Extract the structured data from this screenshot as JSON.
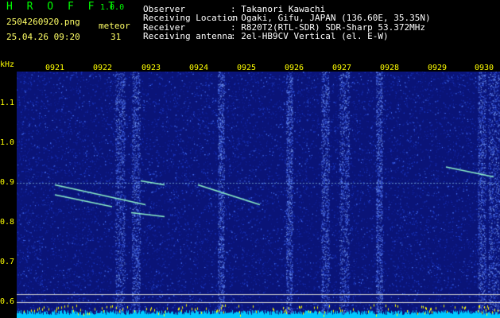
{
  "header": {
    "title": "H R O F F T",
    "version": "1.0.0",
    "filename": "2504260920.png",
    "meteor_label": "meteor",
    "datetime": "25.04.26 09:20",
    "meteor_count": "31",
    "info": [
      {
        "key": "Observer",
        "value": ": Takanori Kawachi"
      },
      {
        "key": "Receiving Location",
        "value": ": Ogaki, Gifu, JAPAN (136.60E, 35.35N)"
      },
      {
        "key": "Receiver",
        "value": ": R820T2(RTL-SDR) SDR-Sharp 53.372MHz"
      },
      {
        "key": "Receiving antenna",
        "value": ": 2el-HB9CV Vertical (el. E-W)"
      }
    ]
  },
  "chart_data": {
    "type": "heatmap",
    "ylabel": "kHz",
    "x_ticks": [
      "0921",
      "0922",
      "0923",
      "0924",
      "0925",
      "0926",
      "0927",
      "0928",
      "0929",
      "0930"
    ],
    "y_ticks": [
      "1.1",
      "1.0",
      "0.9",
      "0.8",
      "0.7",
      "0.6"
    ],
    "ylim": [
      0.58,
      1.18
    ],
    "carrier_khz": 0.9,
    "colors": {
      "background": "#0a1478",
      "noise": "#1e3cc8",
      "signal": "#8cf0c8",
      "carrier": "#aaeeff",
      "minute_line": "#3c5ad2",
      "bottom_bars": "#00c8ff",
      "bottom_peaks": "#ffff00"
    },
    "echoes": [
      {
        "t_start": "0921.0",
        "t_end": "0922.9",
        "f_start": 0.895,
        "f_end": 0.845
      },
      {
        "t_start": "0921.0",
        "t_end": "0922.2",
        "f_start": 0.87,
        "f_end": 0.84
      },
      {
        "t_start": "0922.8",
        "t_end": "0923.3",
        "f_start": 0.905,
        "f_end": 0.895
      },
      {
        "t_start": "0924.0",
        "t_end": "0925.3",
        "f_start": 0.895,
        "f_end": 0.845
      },
      {
        "t_start": "0922.6",
        "t_end": "0923.3",
        "f_start": 0.825,
        "f_end": 0.815
      },
      {
        "t_start": "0929.2",
        "t_end": "0930.2",
        "f_start": 0.94,
        "f_end": 0.915
      }
    ]
  }
}
